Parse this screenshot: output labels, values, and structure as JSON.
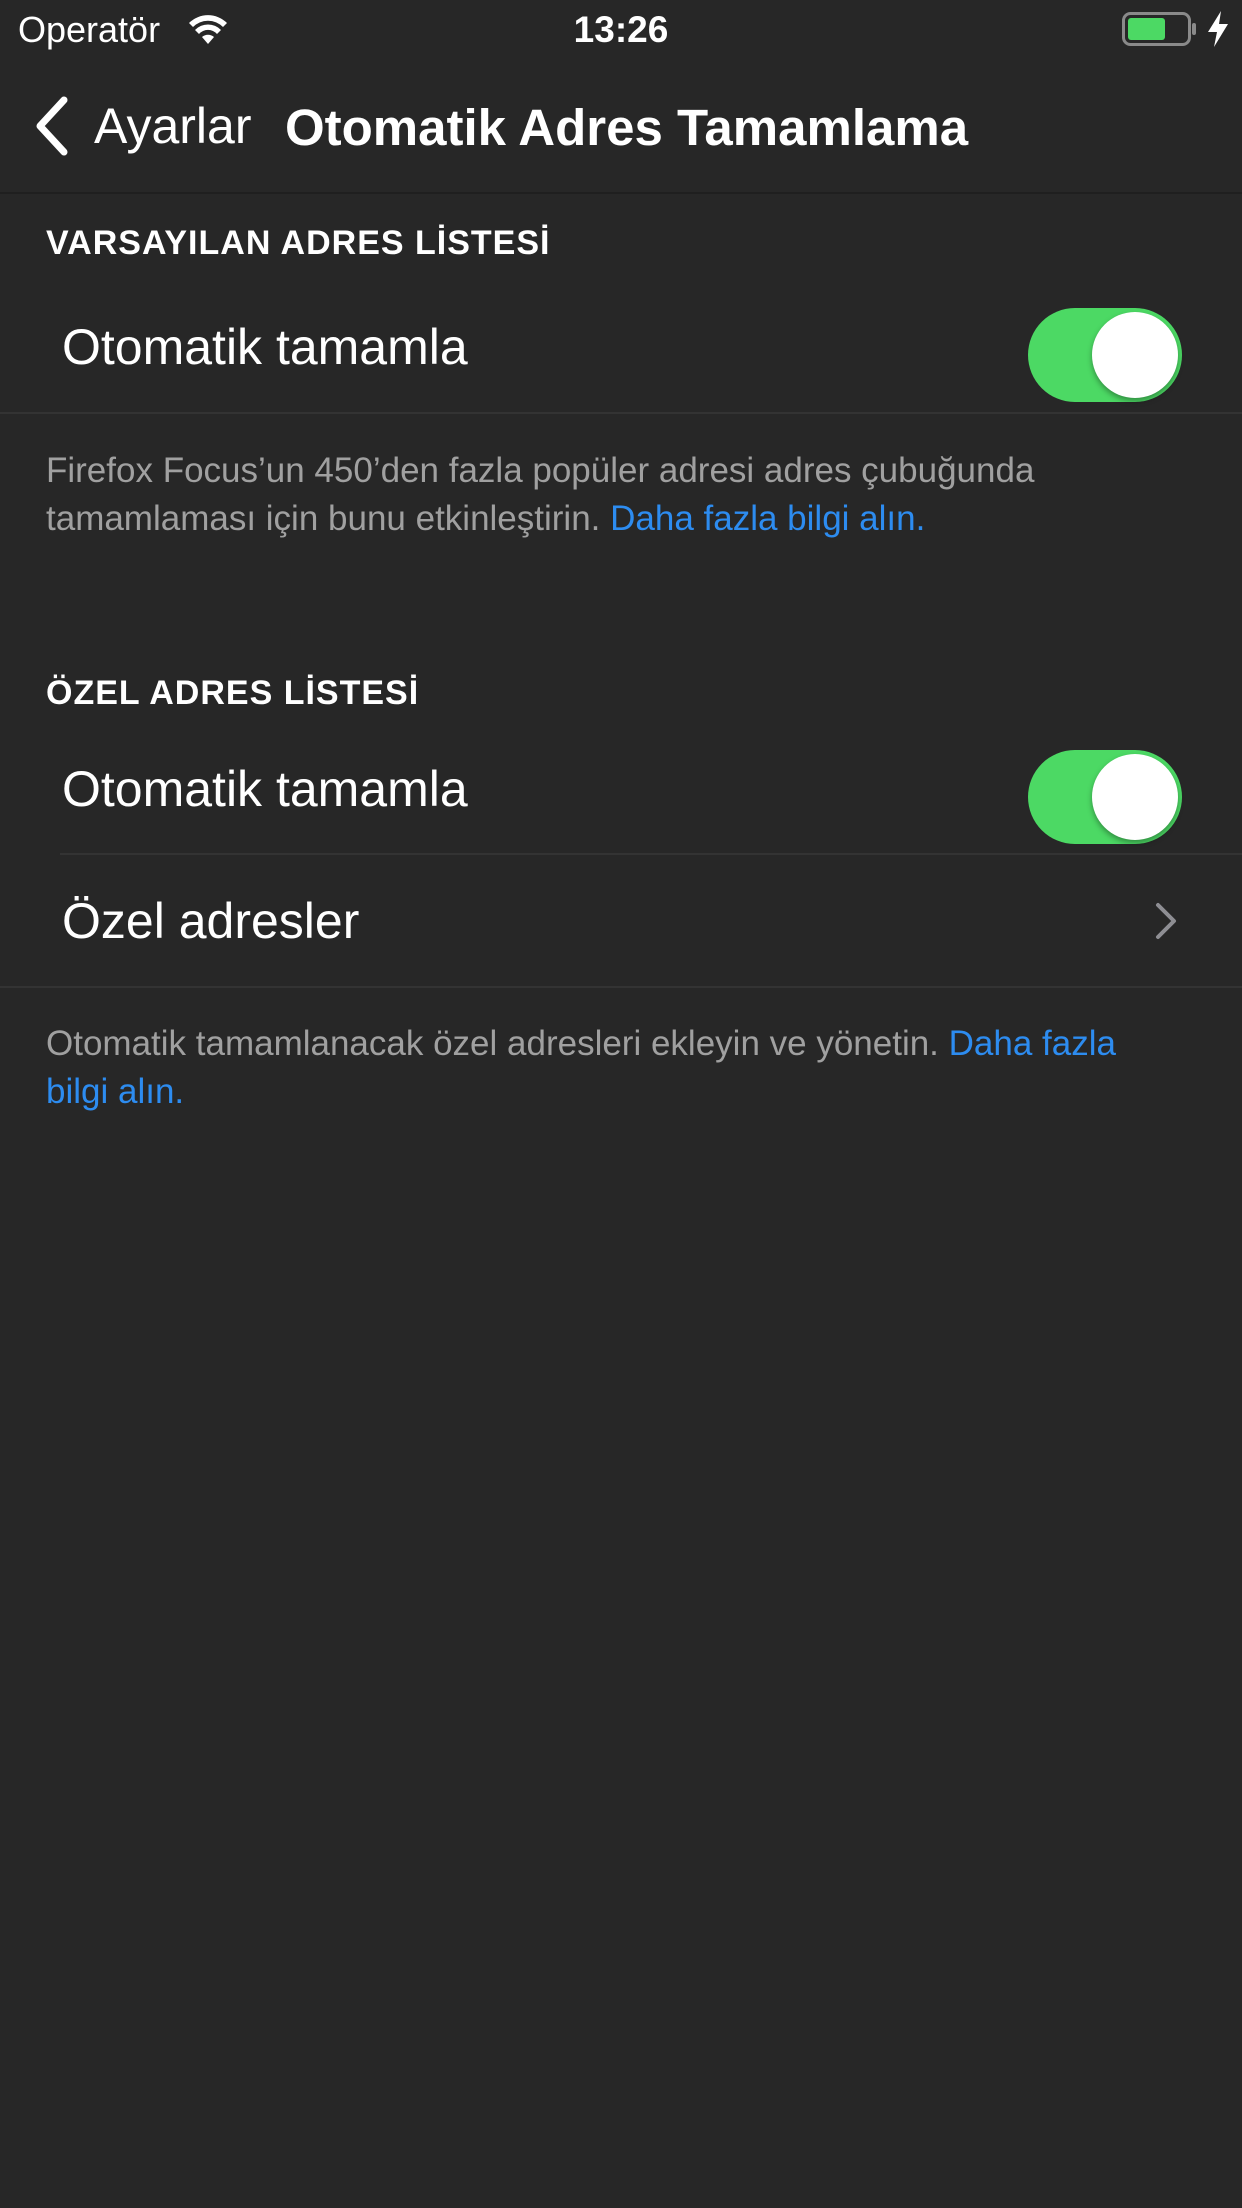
{
  "status_bar": {
    "carrier": "Operatör",
    "time": "13:26",
    "wifi_icon": "wifi-icon",
    "battery_icon": "battery-charging-icon"
  },
  "nav": {
    "back_label": "Ayarlar",
    "title": "Otomatik Adres Tamamlama"
  },
  "default_list": {
    "header": "VARSAYILAN ADRES LİSTESİ",
    "autocomplete_label": "Otomatik tamamla",
    "autocomplete_on": true,
    "footer_text": "Firefox Focus’un 450’den fazla popüler adresi adres çubuğunda tamamlaması için bunu etkinleştirin. ",
    "footer_link": "Daha fazla bilgi alın."
  },
  "custom_list": {
    "header": "ÖZEL ADRES LİSTESİ",
    "autocomplete_label": "Otomatik tamamla",
    "autocomplete_on": true,
    "custom_addresses_label": "Özel adresler",
    "footer_text": "Otomatik tamamlanacak özel adresleri ekleyin ve yönetin. ",
    "footer_link": "Daha fazla bilgi alın."
  },
  "colors": {
    "background": "#272727",
    "toggle_on": "#4cd964",
    "link": "#2d8cf0",
    "secondary_text": "#a0a0a0"
  }
}
